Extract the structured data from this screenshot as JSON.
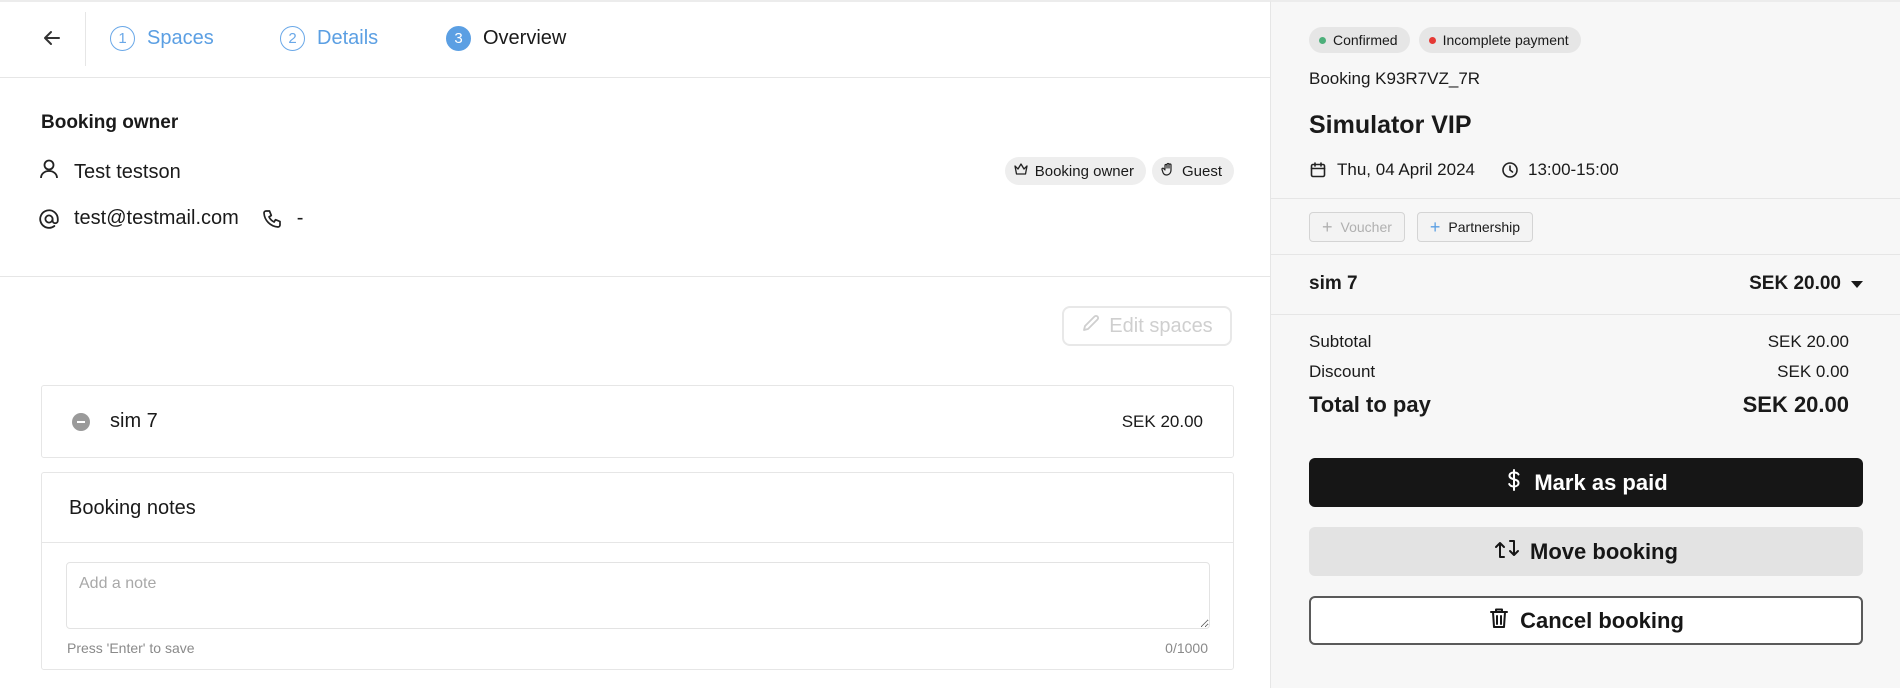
{
  "stepper": {
    "steps": [
      {
        "num": "1",
        "label": "Spaces"
      },
      {
        "num": "2",
        "label": "Details"
      },
      {
        "num": "3",
        "label": "Overview"
      }
    ]
  },
  "owner": {
    "section_title": "Booking owner",
    "name": "Test testson",
    "email": "test@testmail.com",
    "phone": "-",
    "tags": [
      "Booking owner",
      "Guest"
    ]
  },
  "spaces": {
    "edit_label": "Edit spaces",
    "items": [
      {
        "name": "sim 7",
        "price": "SEK 20.00"
      }
    ]
  },
  "notes": {
    "title": "Booking notes",
    "placeholder": "Add a note",
    "hint": "Press 'Enter' to save",
    "counter": "0/1000"
  },
  "summary": {
    "statuses": [
      {
        "label": "Confirmed",
        "color": "#4caf7a"
      },
      {
        "label": "Incomplete payment",
        "color": "#e53935"
      }
    ],
    "booking_id": "Booking K93R7VZ_7R",
    "title": "Simulator VIP",
    "date": "Thu, 04 April 2024",
    "time": "13:00-15:00",
    "chips": [
      "Voucher",
      "Partnership"
    ],
    "line_item": {
      "name": "sim 7",
      "price": "SEK 20.00"
    },
    "subtotal_label": "Subtotal",
    "subtotal": "SEK 20.00",
    "discount_label": "Discount",
    "discount": "SEK 0.00",
    "total_label": "Total to pay",
    "total": "SEK 20.00",
    "actions": {
      "mark_paid": "Mark as paid",
      "move": "Move booking",
      "cancel": "Cancel booking"
    }
  }
}
